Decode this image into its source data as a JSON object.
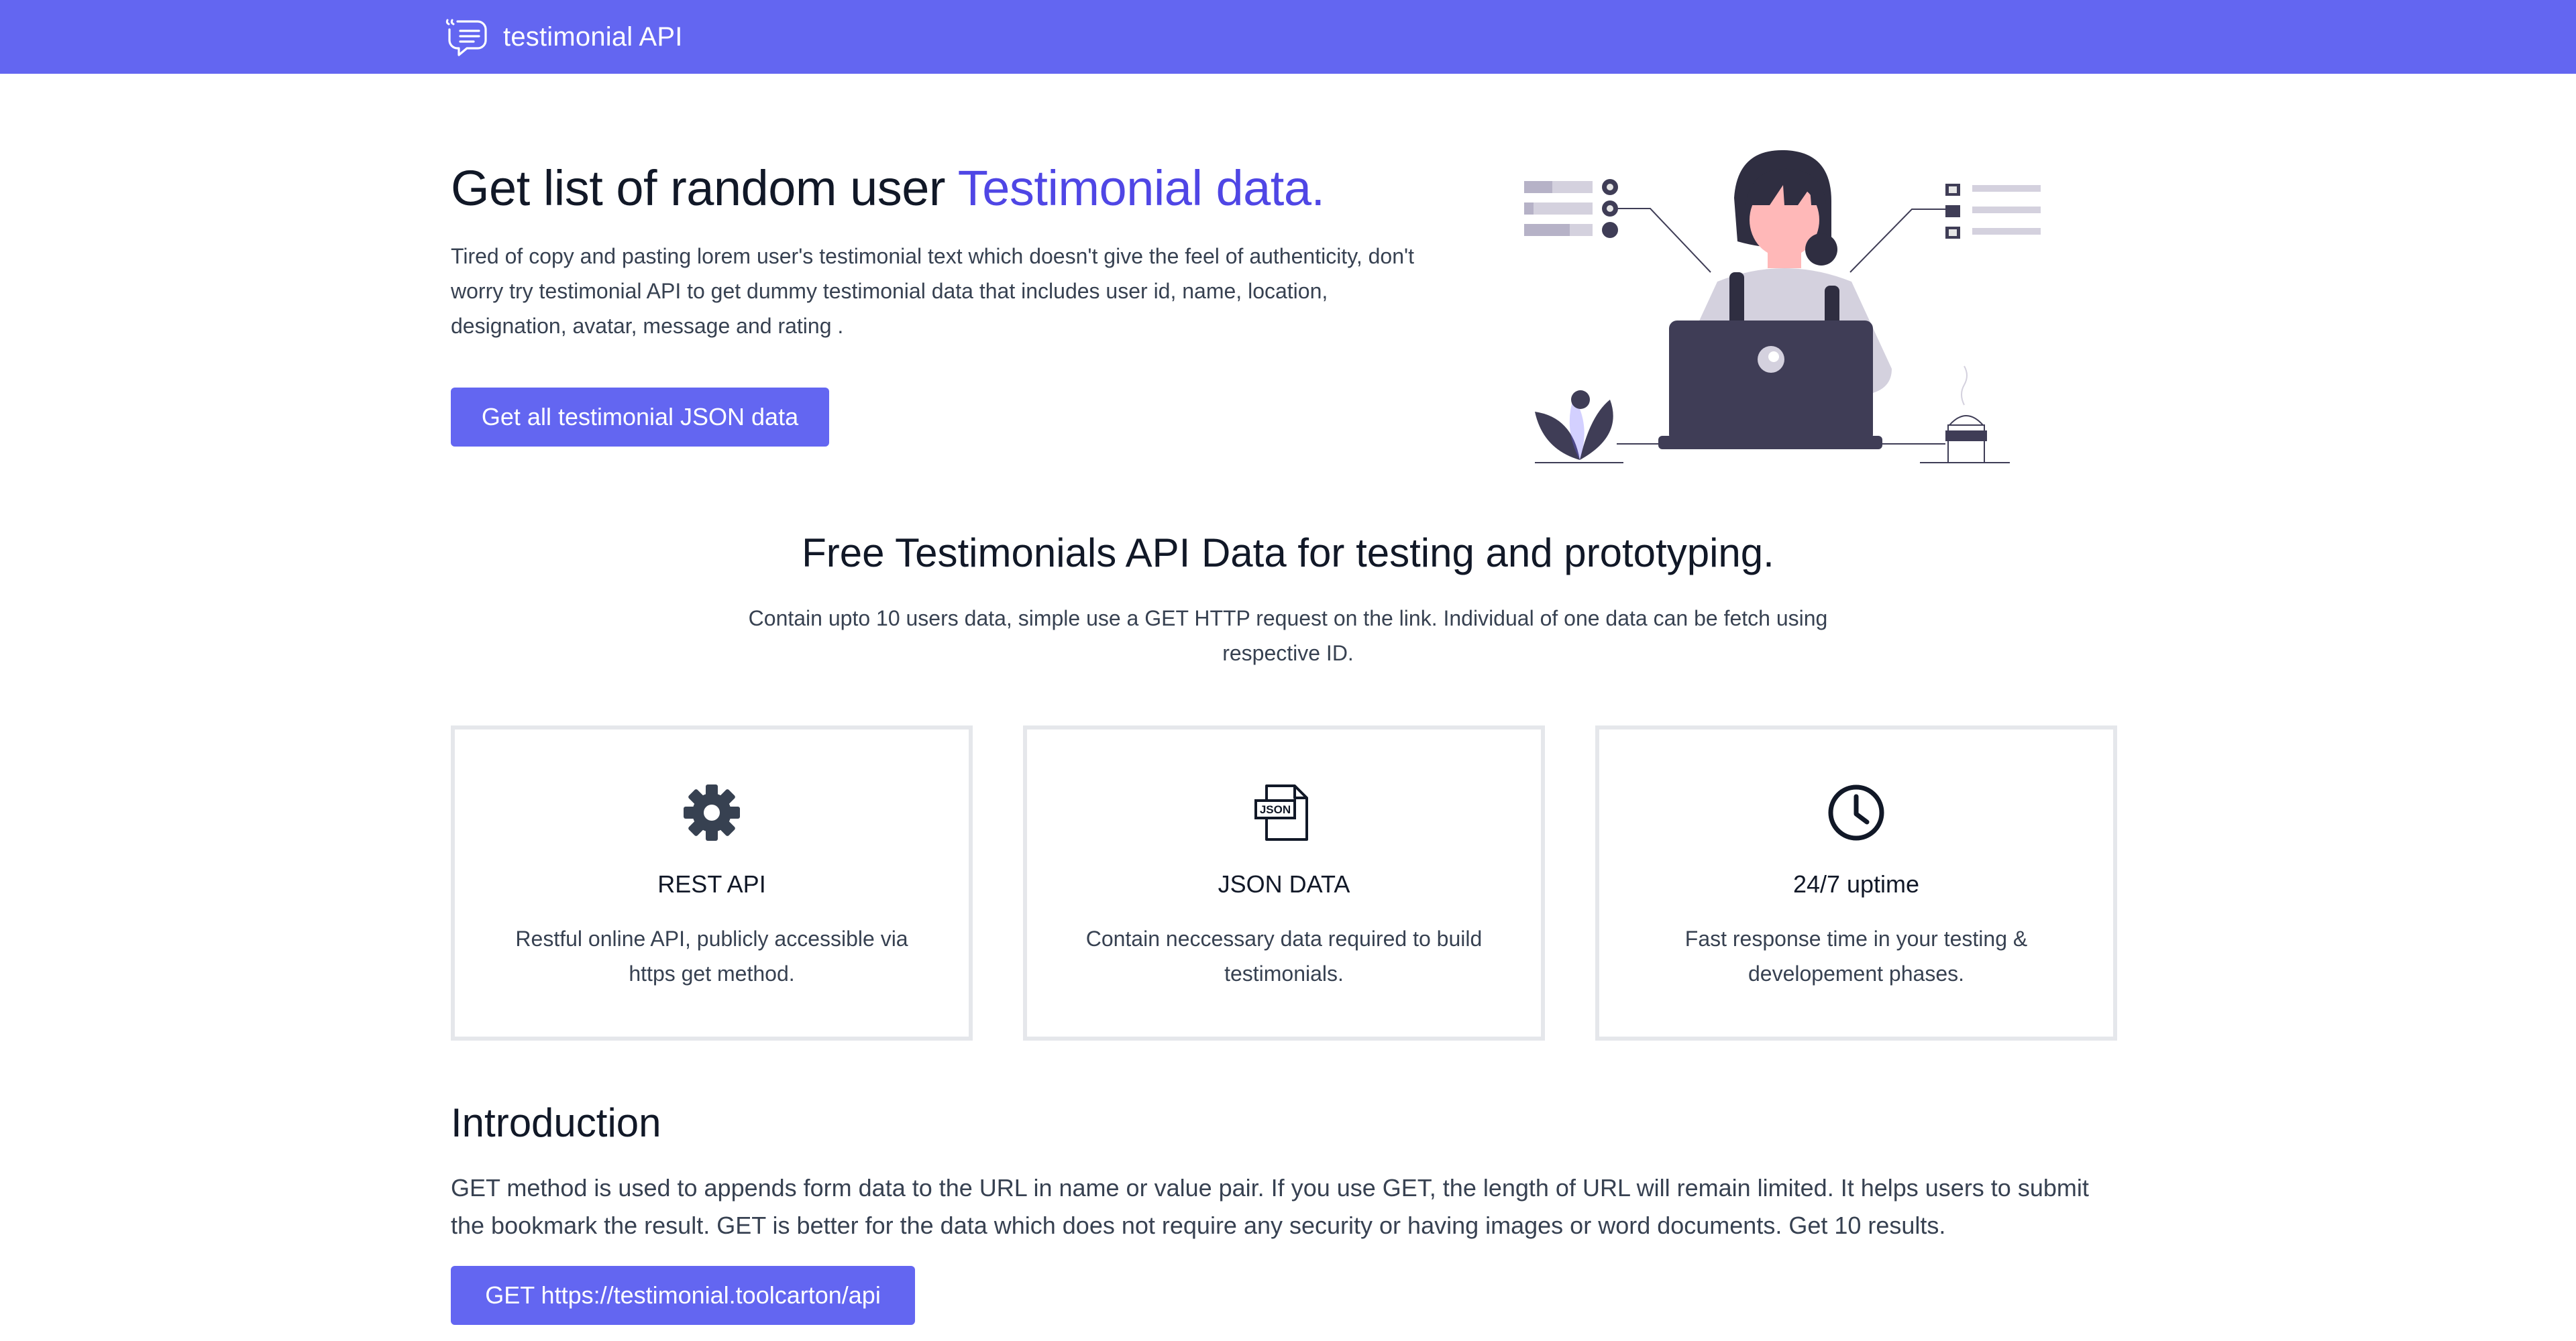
{
  "navbar": {
    "brand_icon": "speech-bubble-quote-icon",
    "brand_name": "testimonial API",
    "color": "#6366f1"
  },
  "hero": {
    "title_main": "Get list of random user ",
    "title_accent": "Testimonial data.",
    "accent_color": "#4f46e5",
    "description": "Tired of copy and pasting lorem user's testimonial text which doesn't give the feel of authenticity, don't worry try testimonial API to get dummy testimonial data that includes user id, name, location, designation, avatar, message and rating .",
    "button_label": "Get all testimonial JSON data",
    "illustration": "woman-working-on-laptop-illustration"
  },
  "features": {
    "title": "Free Testimonials API Data for testing and prototyping.",
    "subtitle": "Contain upto 10 users data, simple use a GET HTTP request on the link. Individual of one data can be fetch using respective ID.",
    "cards": [
      {
        "icon": "gear-icon",
        "title": "REST API",
        "text": "Restful online API, publicly accessible via https get method."
      },
      {
        "icon": "json-file-icon",
        "icon_label": "JSON",
        "title": "JSON DATA",
        "text": "Contain neccessary data required to build testimonials."
      },
      {
        "icon": "clock-icon",
        "title": "24/7 uptime",
        "text": "Fast response time in your testing & developement phases."
      }
    ]
  },
  "introduction": {
    "title": "Introduction",
    "text": "GET method is used to appends form data to the URL in name or value pair. If you use GET, the length of URL will remain limited. It helps users to submit the bookmark the result. GET is better for the data which does not require any security or having images or word documents. Get 10 results.",
    "button_label": "GET https://testimonial.toolcarton/api"
  }
}
